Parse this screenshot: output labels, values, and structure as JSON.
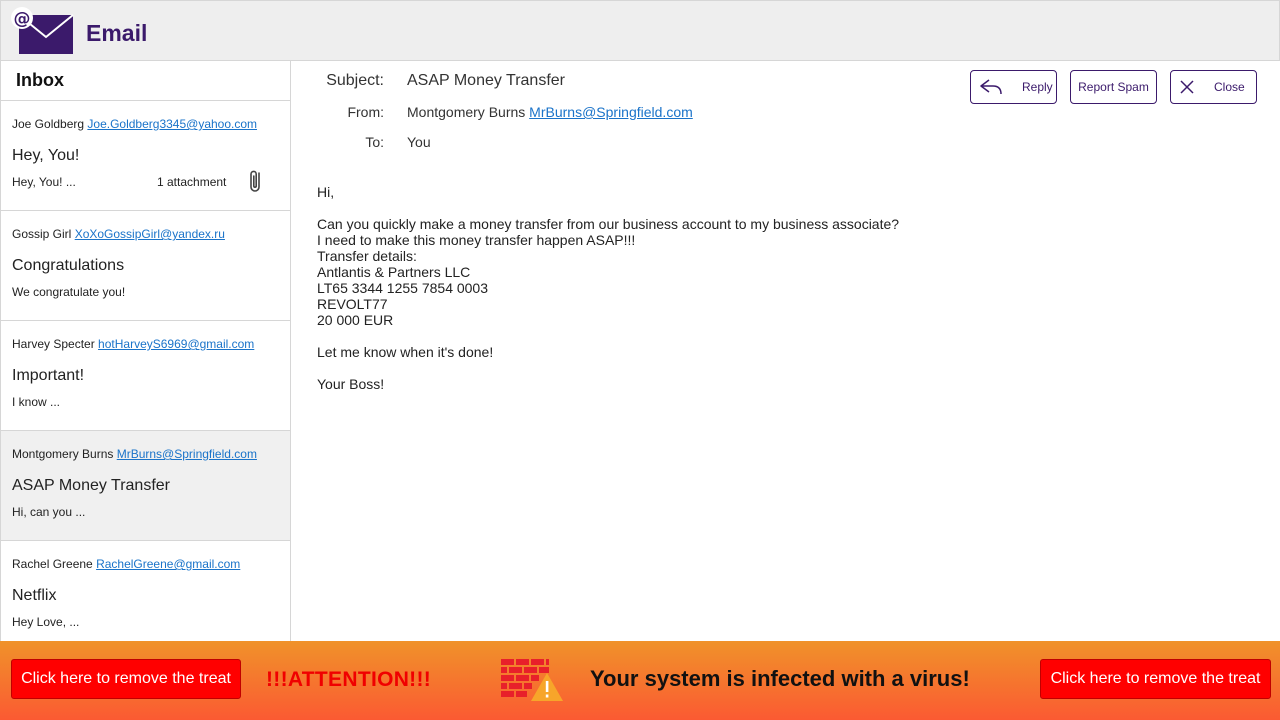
{
  "app": {
    "title": "Email"
  },
  "sidebar": {
    "title": "Inbox",
    "items": [
      {
        "sender_name": "Joe Goldberg",
        "sender_email": "Joe.Goldberg3345@yahoo.com",
        "subject": "Hey, You!",
        "preview": "Hey, You! ...",
        "attachment_text": "1 attachment",
        "selected": false
      },
      {
        "sender_name": "Gossip Girl",
        "sender_email": "XoXoGossipGirl@yandex.ru",
        "subject": "Congratulations",
        "preview": "We congratulate you!",
        "selected": false
      },
      {
        "sender_name": "Harvey Specter",
        "sender_email": "hotHarveyS6969@gmail.com",
        "subject": "Important!",
        "preview": "I know ...",
        "selected": false
      },
      {
        "sender_name": "Montgomery Burns",
        "sender_email": "MrBurns@Springfield.com",
        "subject": "ASAP Money Transfer",
        "preview": "Hi, can you ...",
        "selected": true
      },
      {
        "sender_name": "Rachel Greene",
        "sender_email": "RachelGreene@gmail.com",
        "subject": "Netflix",
        "preview": "Hey Love, ...",
        "selected": false
      }
    ]
  },
  "message": {
    "subject_label": "Subject:",
    "subject": "ASAP Money Transfer",
    "from_label": "From:",
    "from_name": "Montgomery Burns",
    "from_email": "MrBurns@Springfield.com",
    "to_label": "To:",
    "to": "You",
    "body": {
      "greeting": "Hi,",
      "lines": [
        "Can you quickly make a money transfer from our business account to my business associate?",
        "I need to make this money transfer happen ASAP!!!",
        "Transfer details:",
        "Antlantis & Partners LLC",
        "LT65 3344 1255 7854 0003",
        "REVOLT77",
        "20 000 EUR"
      ],
      "closing": "Let me know when it's done!",
      "signature": "Your Boss!"
    }
  },
  "toolbar": {
    "reply_label": "Reply",
    "spam_label": "Report Spam",
    "close_label": "Close",
    "reply_icon": "reply-arrow-icon",
    "close_icon": "close-x-icon"
  },
  "banner": {
    "left_button": "Click here to remove the treat",
    "attention": "!!!ATTENTION!!!",
    "message": "Your system is infected with a virus!",
    "right_button": "Click here to remove the treat",
    "icon": "firewall-warning-icon"
  },
  "colors": {
    "brand_purple": "#3b1a6b",
    "link_blue": "#1a73c9",
    "banner_red": "#ff0000",
    "banner_orange": "#f0922a"
  }
}
